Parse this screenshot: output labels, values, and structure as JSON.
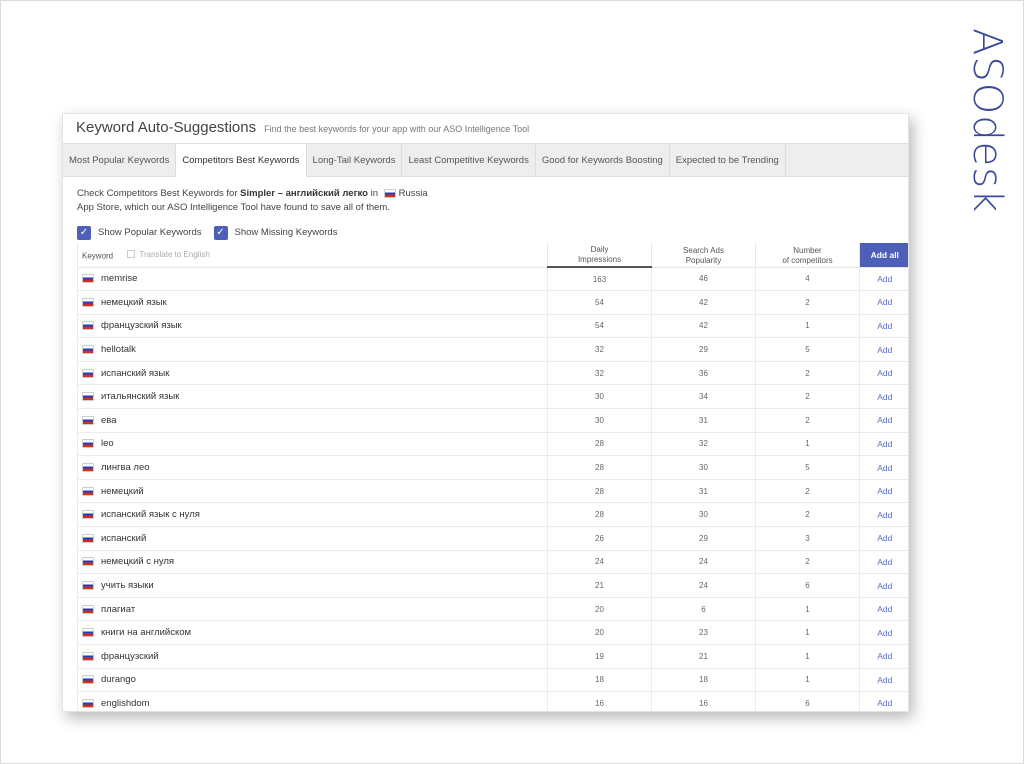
{
  "brand": {
    "name": "ASOdesk"
  },
  "panel": {
    "title": "Keyword Auto-Suggestions",
    "subtitle": "Find the best keywords for your app with our ASO Intelligence Tool"
  },
  "tabs": [
    {
      "label": "Most Popular Keywords",
      "active": false
    },
    {
      "label": "Competitors Best Keywords",
      "active": true
    },
    {
      "label": "Long-Tail Keywords",
      "active": false
    },
    {
      "label": "Least Competitive Keywords",
      "active": false
    },
    {
      "label": "Good for Keywords Boosting",
      "active": false
    },
    {
      "label": "Expected to be Trending",
      "active": false
    }
  ],
  "intro": {
    "prefix": "Check Competitors Best Keywords for ",
    "app_name": "Simpler – английский легко",
    "in": " in ",
    "country": "Russia",
    "suffix": "App Store, which our ASO Intelligence Tool have found to save all of them."
  },
  "toggles": {
    "popular": {
      "label": "Show Popular Keywords",
      "checked": true
    },
    "missing": {
      "label": "Show Missing Keywords",
      "checked": true
    }
  },
  "table": {
    "headers": {
      "keyword": "Keyword",
      "translate": "Translate to English",
      "impressions_line1": "Daily",
      "impressions_line2": "Impressions",
      "popularity_line1": "Search Ads",
      "popularity_line2": "Popularity",
      "competitors_line1": "Number",
      "competitors_line2": "of competitors",
      "add_all": "Add all"
    },
    "add_label": "Add",
    "rows": [
      {
        "keyword": "memrise",
        "impressions": "163",
        "popularity": "46",
        "competitors": "4"
      },
      {
        "keyword": "немецкий язык",
        "impressions": "54",
        "popularity": "42",
        "competitors": "2"
      },
      {
        "keyword": "французский язык",
        "impressions": "54",
        "popularity": "42",
        "competitors": "1"
      },
      {
        "keyword": "hellotalk",
        "impressions": "32",
        "popularity": "29",
        "competitors": "5"
      },
      {
        "keyword": "испанский язык",
        "impressions": "32",
        "popularity": "36",
        "competitors": "2"
      },
      {
        "keyword": "итальянский язык",
        "impressions": "30",
        "popularity": "34",
        "competitors": "2"
      },
      {
        "keyword": "ева",
        "impressions": "30",
        "popularity": "31",
        "competitors": "2"
      },
      {
        "keyword": "leo",
        "impressions": "28",
        "popularity": "32",
        "competitors": "1"
      },
      {
        "keyword": "лингва лео",
        "impressions": "28",
        "popularity": "30",
        "competitors": "5"
      },
      {
        "keyword": "немецкий",
        "impressions": "28",
        "popularity": "31",
        "competitors": "2"
      },
      {
        "keyword": "испанский язык с нуля",
        "impressions": "28",
        "popularity": "30",
        "competitors": "2"
      },
      {
        "keyword": "испанский",
        "impressions": "26",
        "popularity": "29",
        "competitors": "3"
      },
      {
        "keyword": "немецкий с нуля",
        "impressions": "24",
        "popularity": "24",
        "competitors": "2"
      },
      {
        "keyword": "учить языки",
        "impressions": "21",
        "popularity": "24",
        "competitors": "6"
      },
      {
        "keyword": "плагиат",
        "impressions": "20",
        "popularity": "6",
        "competitors": "1"
      },
      {
        "keyword": "книги на английском",
        "impressions": "20",
        "popularity": "23",
        "competitors": "1"
      },
      {
        "keyword": "французский",
        "impressions": "19",
        "popularity": "21",
        "competitors": "1"
      },
      {
        "keyword": "durango",
        "impressions": "18",
        "popularity": "18",
        "competitors": "1"
      },
      {
        "keyword": "englishdom",
        "impressions": "16",
        "popularity": "16",
        "competitors": "6"
      }
    ]
  }
}
